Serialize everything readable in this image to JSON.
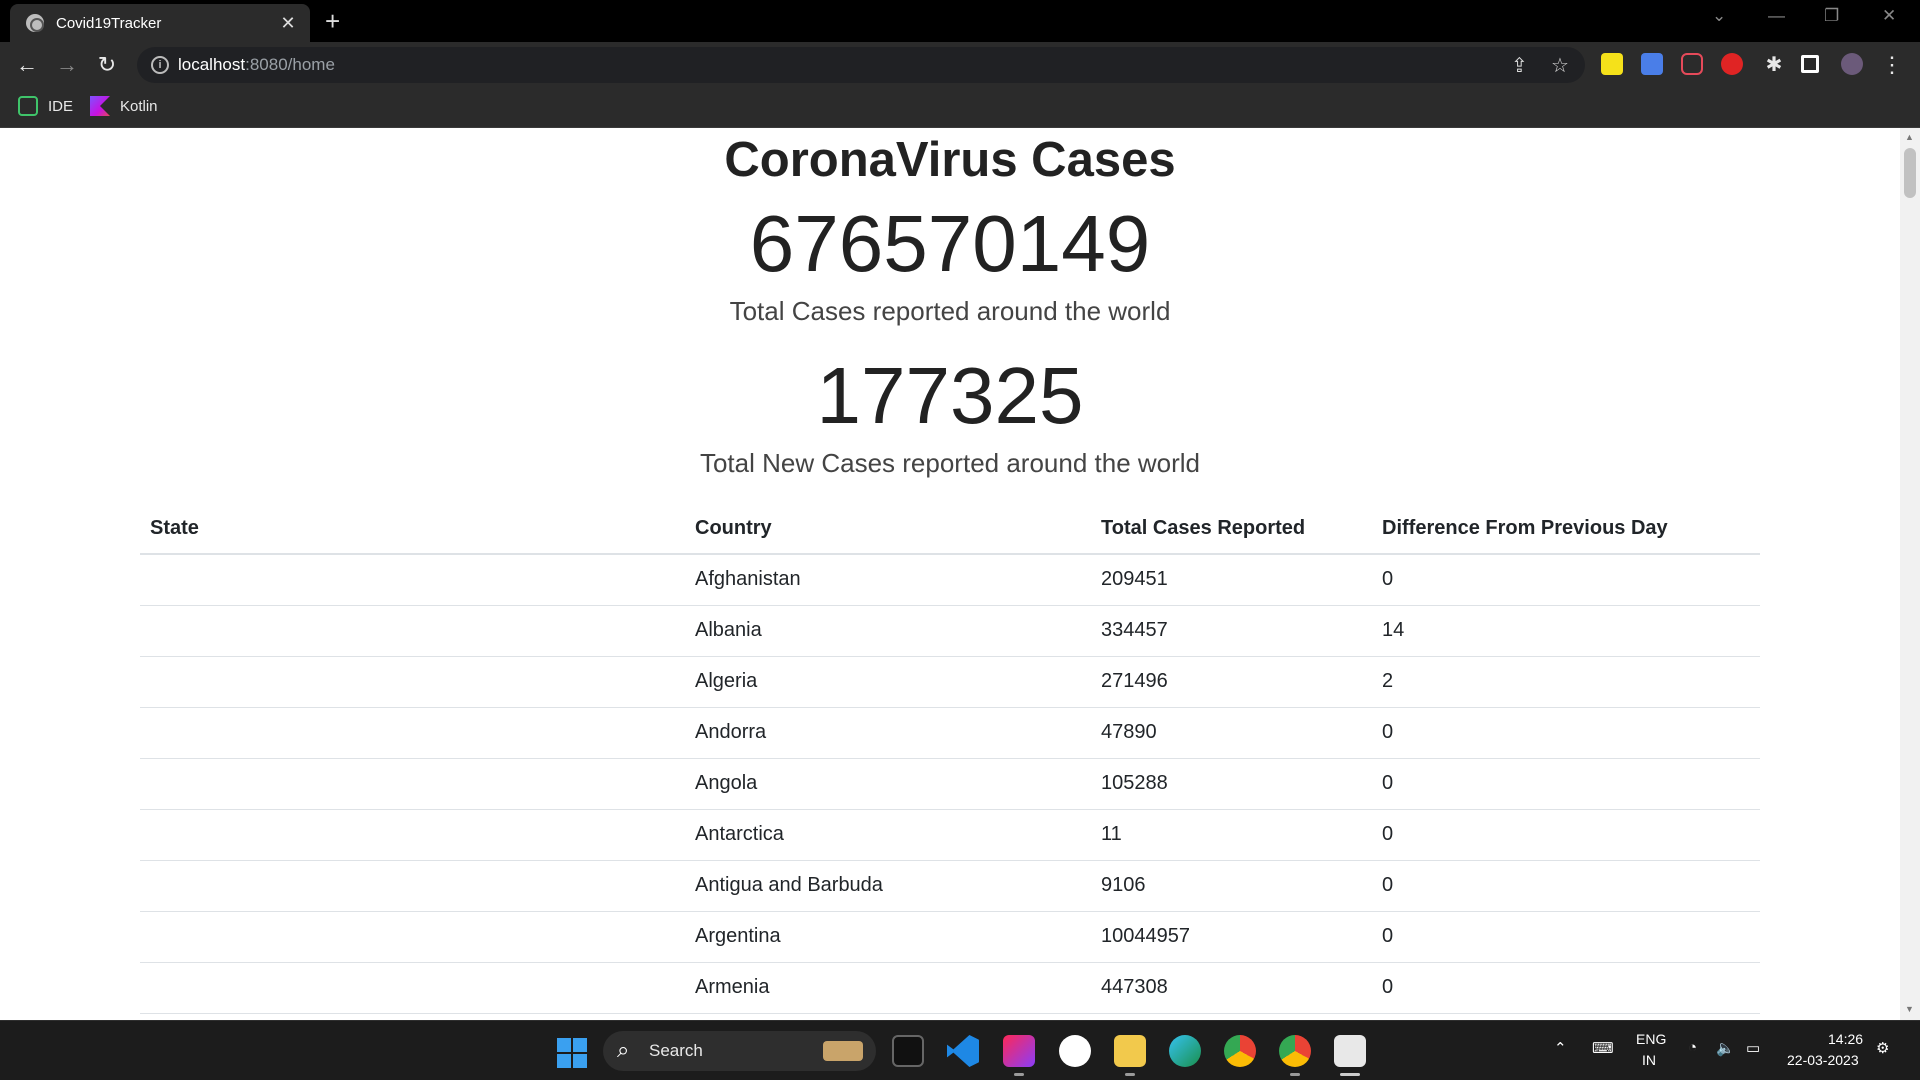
{
  "browser": {
    "tab_title": "Covid19Tracker",
    "tab_close": "✕",
    "new_tab": "+",
    "url_host": "localhost",
    "url_rest": ":8080/home",
    "bookmarks": [
      {
        "label": "IDE",
        "icon": "ide-icon"
      },
      {
        "label": "Kotlin",
        "icon": "kotlin-icon"
      }
    ]
  },
  "page": {
    "heading": "CoronaVirus Cases",
    "total_cases": "676570149",
    "total_cases_label": "Total Cases reported around the world",
    "new_cases": "177325",
    "new_cases_label": "Total New Cases reported around the world",
    "table": {
      "headers": [
        "State",
        "Country",
        "Total Cases Reported",
        "Difference From Previous Day"
      ],
      "rows": [
        {
          "state": "",
          "country": "Afghanistan",
          "total": "209451",
          "diff": "0"
        },
        {
          "state": "",
          "country": "Albania",
          "total": "334457",
          "diff": "14"
        },
        {
          "state": "",
          "country": "Algeria",
          "total": "271496",
          "diff": "2"
        },
        {
          "state": "",
          "country": "Andorra",
          "total": "47890",
          "diff": "0"
        },
        {
          "state": "",
          "country": "Angola",
          "total": "105288",
          "diff": "0"
        },
        {
          "state": "",
          "country": "Antarctica",
          "total": "11",
          "diff": "0"
        },
        {
          "state": "",
          "country": "Antigua and Barbuda",
          "total": "9106",
          "diff": "0"
        },
        {
          "state": "",
          "country": "Argentina",
          "total": "10044957",
          "diff": "0"
        },
        {
          "state": "",
          "country": "Armenia",
          "total": "447308",
          "diff": "0"
        }
      ]
    }
  },
  "taskbar": {
    "search_label": "Search",
    "lang_top": "ENG",
    "lang_bottom": "IN",
    "time": "14:26",
    "date": "22-03-2023"
  }
}
